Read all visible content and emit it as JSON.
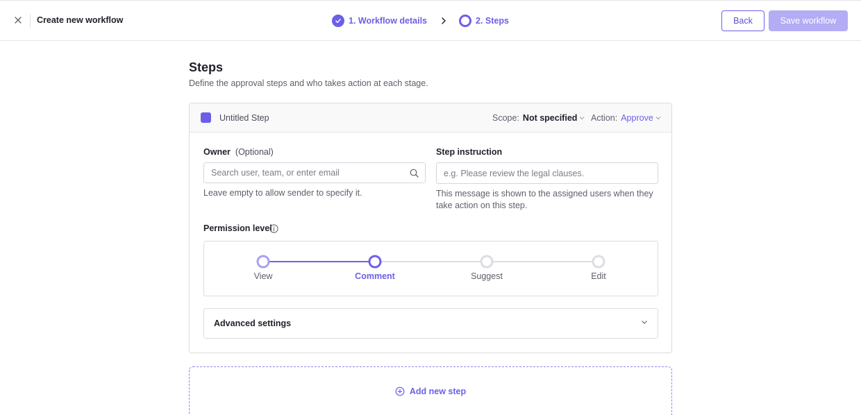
{
  "header": {
    "title": "Create new workflow",
    "steps": [
      {
        "label": "1. Workflow details",
        "state": "completed"
      },
      {
        "label": "2. Steps",
        "state": "current"
      }
    ],
    "back_label": "Back",
    "save_label": "Save workflow"
  },
  "section": {
    "title": "Steps",
    "subtitle": "Define the approval steps and who takes action at each stage."
  },
  "step": {
    "name": "Untitled Step",
    "scope_label": "Scope:",
    "scope_value": "Not specified",
    "action_label": "Action:",
    "action_value": "Approve",
    "owner": {
      "label": "Owner",
      "optional": "(Optional)",
      "placeholder": "Search user, team, or enter email",
      "value": "",
      "help": "Leave empty to allow sender to specify it."
    },
    "instruction": {
      "label": "Step instruction",
      "placeholder": "e.g. Please review the legal clauses.",
      "value": "",
      "help_line1": "This message is shown to the assigned users when they",
      "help_line2": "take action on this step."
    },
    "permission": {
      "label": "Permission level",
      "levels": [
        "View",
        "Comment",
        "Suggest",
        "Edit"
      ],
      "selected_index": 1
    },
    "advanced_label": "Advanced settings"
  },
  "add_step_label": "Add new step",
  "colors": {
    "accent": "#6c5fe7",
    "accent_light": "#a79ff2",
    "disabled_button": "#b4acf4",
    "track_inactive": "#dcdce2"
  }
}
